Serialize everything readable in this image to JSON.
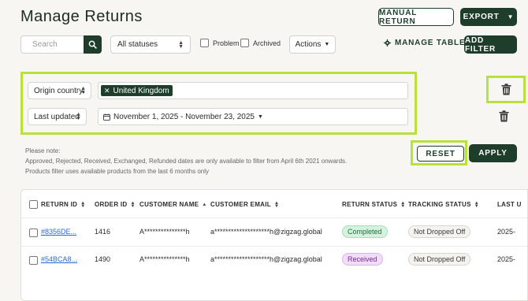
{
  "page": {
    "title": "Manage Returns"
  },
  "header": {
    "manual_return_label": "MANUAL RETURN",
    "export_label": "EXPORT"
  },
  "toolbar": {
    "search_placeholder": "Search",
    "status_select_value": "All statuses",
    "problem_label": "Problem",
    "archived_label": "Archived",
    "actions_label": "Actions",
    "manage_table_label": "MANAGE TABLE",
    "add_filter_label": "ADD FILTER"
  },
  "filters": [
    {
      "field": "Origin country:",
      "chip": "United Kingdom"
    },
    {
      "field": "Last updated",
      "value": "November 1, 2025 - November 23, 2025"
    }
  ],
  "note": {
    "lines": [
      "Please note:",
      "Approved, Rejected, Received, Exchanged, Refunded dates are only available to filter from April 6th 2021 onwards.",
      "Products filter uses available products from the last 6 months only"
    ]
  },
  "filter_actions": {
    "reset_label": "RESET",
    "apply_label": "APPLY"
  },
  "table": {
    "columns": [
      "RETURN ID",
      "ORDER ID",
      "CUSTOMER NAME",
      "CUSTOMER EMAIL",
      "RETURN STATUS",
      "TRACKING STATUS",
      "LAST U"
    ],
    "rows": [
      {
        "return_id": "#8356DE...",
        "order_id": "1416",
        "customer_name": "A***************h",
        "customer_email": "a********************h@zigzag.global",
        "return_status": "Completed",
        "tracking_status": "Not Dropped Off",
        "last_updated": "2025-"
      },
      {
        "return_id": "#54BCA8...",
        "order_id": "1490",
        "customer_name": "A***************h",
        "customer_email": "a********************h@zigzag.global",
        "return_status": "Received",
        "tracking_status": "Not Dropped Off",
        "last_updated": "2025-"
      }
    ]
  },
  "colors": {
    "brand_dark_green": "#1f3d2b",
    "highlight_lime": "#b8e23a",
    "link_blue": "#2a6bd8"
  }
}
